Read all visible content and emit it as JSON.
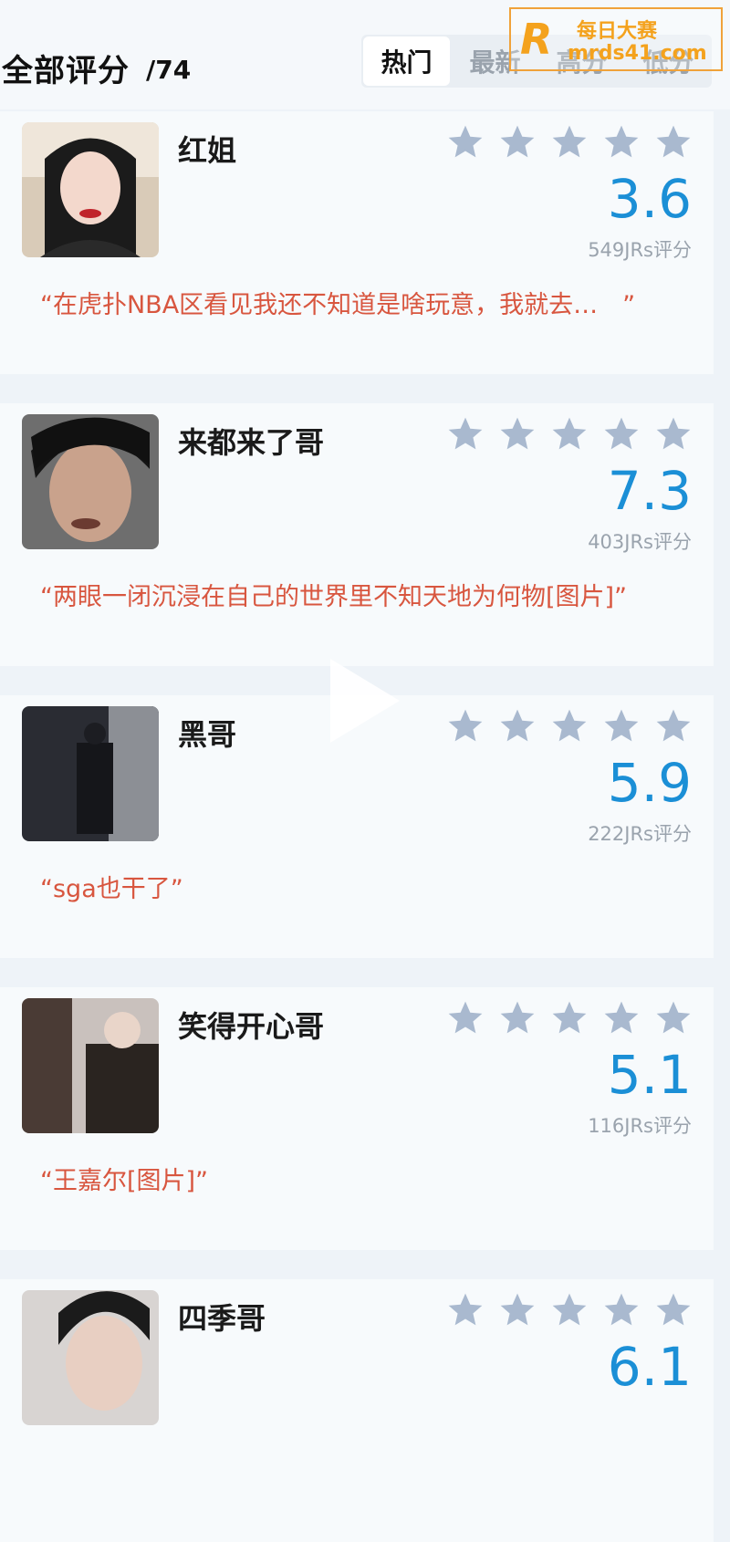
{
  "header": {
    "title": "全部评分",
    "count": "/74",
    "tabs": [
      {
        "label": "热门",
        "active": true
      },
      {
        "label": "最新",
        "active": false
      },
      {
        "label": "高分",
        "active": false
      },
      {
        "label": "低分",
        "active": false
      }
    ]
  },
  "watermark": {
    "logo_letter": "R",
    "line1": "每日大赛",
    "line2": "mrds41.com"
  },
  "colors": {
    "score": "#1b8fd6",
    "quote": "#d8563f",
    "star": "#a9b9cf"
  },
  "reviews": [
    {
      "name": "红姐",
      "score": "3.6",
      "raters": "549JRs评分",
      "quote": "“在虎扑NBA区看见我还不知道是啥玩意，我就去…　”",
      "avatar_icon": "woman-portrait"
    },
    {
      "name": "来都来了哥",
      "score": "7.3",
      "raters": "403JRs评分",
      "quote": "“两眼一闭沉浸在自己的世界里不知天地为何物[图片]”",
      "avatar_icon": "man-portrait"
    },
    {
      "name": "黑哥",
      "score": "5.9",
      "raters": "222JRs评分",
      "quote": "“sga也干了”",
      "avatar_icon": "dark-room-photo"
    },
    {
      "name": "笑得开心哥",
      "score": "5.1",
      "raters": "116JRs评分",
      "quote": "“王嘉尔[图片]”",
      "avatar_icon": "two-people-photo"
    },
    {
      "name": "四季哥",
      "score": "6.1",
      "raters": "",
      "quote": "",
      "avatar_icon": "young-man-portrait"
    }
  ]
}
